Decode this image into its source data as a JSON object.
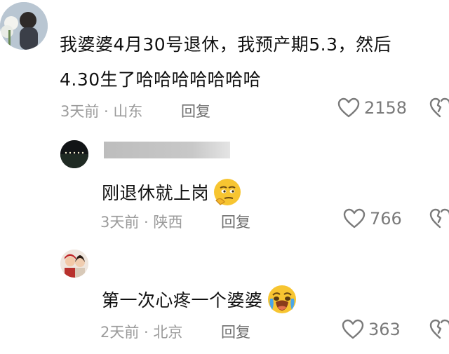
{
  "comments": [
    {
      "text_line1": "我婆婆4月30号退休，我预产期5.3，然后",
      "text_line2": "4.30生了哈哈哈哈哈哈哈",
      "meta": "3天前 · 山东",
      "reply_label": "回复",
      "likes": "2158"
    },
    {
      "text": "刚退休就上岗",
      "emoji": "thinking-face-emoji",
      "meta": "3天前 · 陕西",
      "reply_label": "回复",
      "likes": "766"
    },
    {
      "text": "第一次心疼一个婆婆",
      "emoji": "crying-face-emoji",
      "meta": "2天前 · 北京",
      "reply_label": "回复",
      "likes": "363"
    }
  ],
  "icons": {
    "like": "heart-outline-icon",
    "dislike": "broken-heart-icon"
  },
  "colors": {
    "meta_gray": "#9b9b9b",
    "icon_gray": "#7a7a7a",
    "emoji_yellow": "#f7c531"
  }
}
